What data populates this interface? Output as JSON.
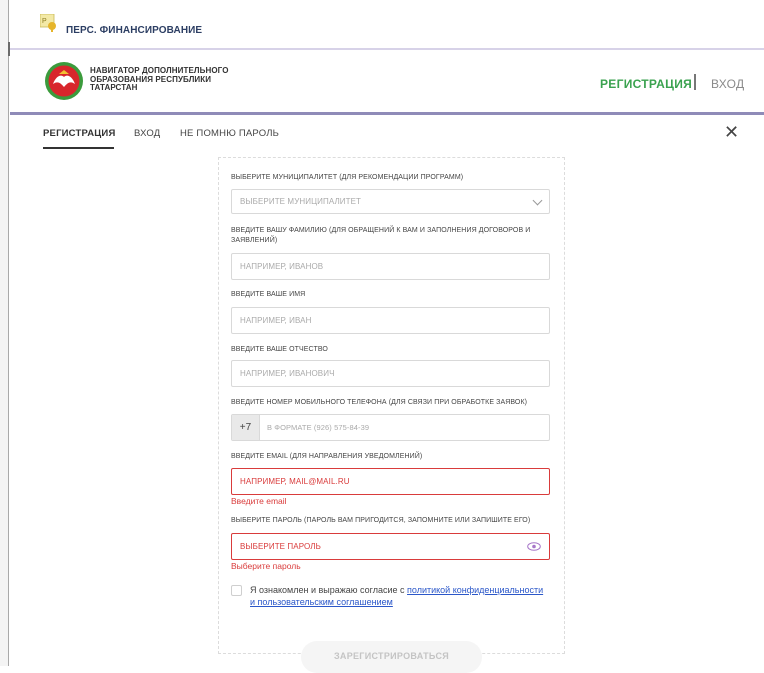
{
  "top_bar": {
    "title": "ПЕРС. ФИНАНСИРОВАНИЕ"
  },
  "header": {
    "title_lines": [
      "НАВИГАТОР ДОПОЛНИТЕЛЬНОГО",
      "ОБРАЗОВАНИЯ РЕСПУБЛИКИ",
      "ТАТАРСТАН"
    ],
    "register_link": "РЕГИСТРАЦИЯ",
    "login_link": "ВХОД"
  },
  "tabs": [
    {
      "label": "РЕГИСТРАЦИЯ",
      "active": true
    },
    {
      "label": "ВХОД",
      "active": false
    },
    {
      "label": "НЕ ПОМНЮ ПАРОЛЬ",
      "active": false
    }
  ],
  "close_label": "✕",
  "form": {
    "municipality": {
      "label": "ВЫБЕРИТЕ МУНИЦИПАЛИТЕТ (ДЛЯ РЕКОМЕНДАЦИИ ПРОГРАММ)",
      "placeholder": "ВЫБЕРИТЕ МУНИЦИПАЛИТЕТ"
    },
    "lastname": {
      "label": "ВВЕДИТЕ ВАШУ ФАМИЛИЮ (ДЛЯ ОБРАЩЕНИЙ К ВАМ И ЗАПОЛНЕНИЯ ДОГОВОРОВ И ЗАЯВЛЕНИЙ)",
      "placeholder": "НАПРИМЕР, ИВАНОВ"
    },
    "firstname": {
      "label": "ВВЕДИТЕ ВАШЕ ИМЯ",
      "placeholder": "НАПРИМЕР, ИВАН"
    },
    "patronymic": {
      "label": "ВВЕДИТЕ ВАШЕ ОТЧЕСТВО",
      "placeholder": "НАПРИМЕР, ИВАНОВИЧ"
    },
    "phone": {
      "label": "ВВЕДИТЕ НОМЕР МОБИЛЬНОГО ТЕЛЕФОНА (ДЛЯ СВЯЗИ ПРИ ОБРАБОТКЕ ЗАЯВОК)",
      "prefix": "+7",
      "placeholder": "В ФОРМАТЕ (926) 575-84-39"
    },
    "email": {
      "label": "ВВЕДИТЕ EMAIL (ДЛЯ НАПРАВЛЕНИЯ УВЕДОМЛЕНИЙ)",
      "placeholder": "НАПРИМЕР, MAIL@MAIL.RU",
      "error": "Введите email"
    },
    "password": {
      "label": "ВЫБЕРИТЕ ПАРОЛЬ (ПАРОЛЬ ВАМ ПРИГОДИТСЯ, ЗАПОМНИТЕ ИЛИ ЗАПИШИТЕ ЕГО)",
      "placeholder": "ВЫБЕРИТЕ ПАРОЛЬ",
      "error": "Выберите пароль"
    },
    "consent": {
      "text": "Я ознакомлен и выражаю согласие с ",
      "link": "политикой конфиденциальности и пользовательским соглашением"
    },
    "submit_label": "ЗАРЕГИСТРИРОВАТЬСЯ"
  },
  "colors": {
    "accent_green": "#3aa24f",
    "error_red": "#d93b3b",
    "header_line": "#8f8bb8",
    "link_blue": "#2b57c9"
  }
}
